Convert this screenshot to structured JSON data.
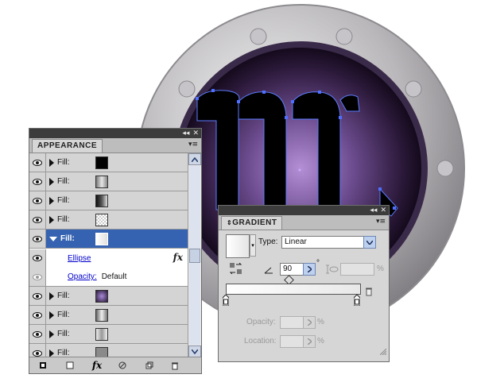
{
  "appearance_panel": {
    "title": "APPEARANCE",
    "collapse_glyph": "◂◂",
    "close_glyph": "✕",
    "menu_glyph": "▾≡",
    "rows": [
      {
        "label": "Fill:",
        "swatch": "#000000"
      },
      {
        "label": "Fill:",
        "swatch": "gray-gradient"
      },
      {
        "label": "Fill:",
        "swatch": "dark-gradient"
      },
      {
        "label": "Fill:",
        "swatch": "checker"
      },
      {
        "label": "Fill:",
        "swatch": "white-gradient",
        "selected": true
      }
    ],
    "sub_ellipse": "Ellipse",
    "fx_glyph": "fx",
    "opacity_label": "Opacity:",
    "opacity_value": "Default",
    "rows_after": [
      {
        "label": "Fill:",
        "swatch": "radial-purple"
      },
      {
        "label": "Fill:",
        "swatch": "gray-gradient"
      },
      {
        "label": "Fill:",
        "swatch": "light-gradient"
      },
      {
        "label": "Fill:",
        "swatch": "gray"
      }
    ],
    "bottom_fx": "fx"
  },
  "gradient_panel": {
    "title": "GRADIENT",
    "collapse_glyph": "◂◂",
    "close_glyph": "✕",
    "menu_glyph": "▾≡",
    "type_label": "Type:",
    "type_value": "Linear",
    "angle_value": "90",
    "degree_glyph": "°",
    "percent": "%",
    "opacity_label": "Opacity:",
    "location_label": "Location:"
  },
  "colors": {
    "selection_blue": "#3563b1",
    "panel_gray": "#d6d6d6",
    "link_blue": "#0000cc"
  }
}
